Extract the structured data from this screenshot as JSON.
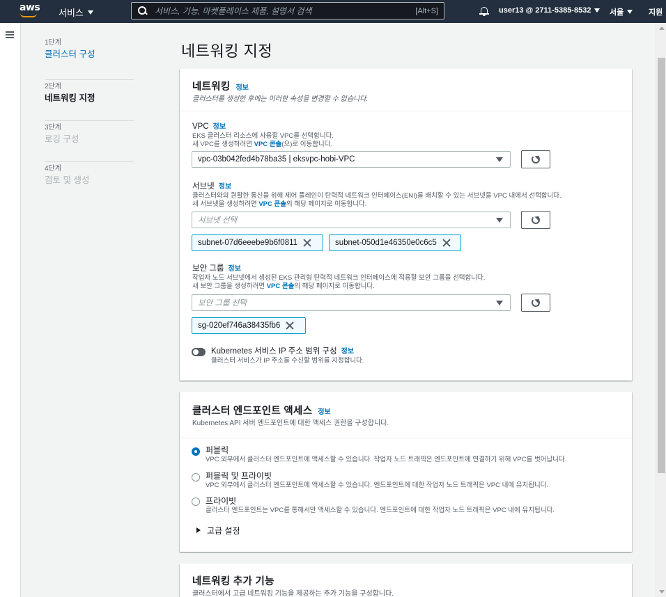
{
  "topnav": {
    "logo": "aws",
    "services_label": "서비스",
    "search_placeholder": "서비스, 기능, 마켓플레이스 제품, 설명서 검색",
    "search_shortcut": "[Alt+S]",
    "account": "user13 @ 2711-5385-8532",
    "region": "서울",
    "support": "지원"
  },
  "steps": [
    {
      "num": "1단계",
      "title": "클러스터 구성",
      "state": "done"
    },
    {
      "num": "2단계",
      "title": "네트워킹 지정",
      "state": "current"
    },
    {
      "num": "3단계",
      "title": "로깅 구성",
      "state": "disabled"
    },
    {
      "num": "4단계",
      "title": "검토 및 생성",
      "state": "disabled"
    }
  ],
  "page_title": "네트워킹 지정",
  "networking": {
    "title": "네트워킹",
    "info": "정보",
    "desc": "클러스터를 생성한 후에는 이러한 속성을 변경할 수 없습니다.",
    "vpc": {
      "label": "VPC",
      "info": "정보",
      "hint1": "EKS 클러스터 리소스에 사용할 VPC를 선택합니다.",
      "hint2_pre": "새 VPC를 생성하려면 ",
      "hint2_link": "VPC 콘솔",
      "hint2_post": "(으)로 이동합니다.",
      "value": "vpc-03b042fed4b78ba35 | eksvpc-hobi-VPC"
    },
    "subnet": {
      "label": "서브넷",
      "info": "정보",
      "hint1": "클러스터와의 원활한 통신을 위해 제어 플레인이 탄력적 네트워크 인터페이스(ENI)를 배치할 수 있는 서브넷을 VPC 내에서 선택합니다.",
      "hint2_pre": "새 서브넷을 생성하려면 ",
      "hint2_link": "VPC 콘솔",
      "hint2_post": "의 해당 페이지로 이동합니다.",
      "placeholder": "서브넷 선택",
      "tokens": [
        "subnet-07d6eeebe9b6f0811",
        "subnet-050d1e46350e0c6c5"
      ]
    },
    "sg": {
      "label": "보안 그룹",
      "info": "정보",
      "hint1": "작업자 노드 서브넷에서 생성된 EKS 관리형 탄력적 네트워크 인터페이스에 적용할 보안 그룹을 선택합니다.",
      "hint2_pre": "새 보안 그룹을 생성하려면 ",
      "hint2_link": "VPC 콘솔",
      "hint2_post": "의 해당 페이지로 이동합니다.",
      "placeholder": "보안 그룹 선택",
      "tokens": [
        "sg-020ef746a38435fb6"
      ]
    },
    "k8s_ip": {
      "label": "Kubernetes 서비스 IP 주소 범위 구성",
      "info": "정보",
      "hint": "클러스터 서비스가 IP 주소를 수신할 범위를 지정합니다.",
      "enabled": false
    }
  },
  "endpoint": {
    "title": "클러스터 엔드포인트 액세스",
    "info": "정보",
    "desc": "Kubernetes API 서버 엔드포인트에 대한 액세스 권한을 구성합니다.",
    "options": [
      {
        "label": "퍼블릭",
        "desc": "VPC 외부에서 클러스터 엔드포인트에 액세스할 수 있습니다. 작업자 노드 트래픽은 엔드포인트에 연결하기 위해 VPC를 벗어납니다.",
        "selected": true
      },
      {
        "label": "퍼블릭 및 프라이빗",
        "desc": "VPC 외부에서 클러스터 엔드포인트에 액세스할 수 있습니다. 엔드포인트에 대한 작업자 노드 트래픽은 VPC 내에 유지됩니다.",
        "selected": false
      },
      {
        "label": "프라이빗",
        "desc": "클러스터 엔드포인트는 VPC를 통해서만 액세스할 수 있습니다. 엔드포인트에 대한 작업자 노드 트래픽은 VPC 내에 유지됩니다.",
        "selected": false
      }
    ],
    "advanced": "고급 설정"
  },
  "addons": {
    "title": "네트워킹 추가 기능",
    "desc": "클러스터에서 고급 네트워킹 기능을 제공하는 추가 기능을 구성합니다."
  },
  "colors": {
    "nav": "#232f3e",
    "accent": "#0073bb",
    "token_border": "#00a1c9",
    "brand_orange": "#ff9900"
  }
}
